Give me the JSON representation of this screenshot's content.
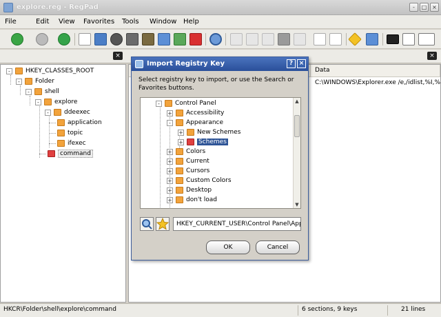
{
  "window": {
    "title": "explore.reg - RegPad",
    "controls": [
      "-",
      "□",
      "×"
    ]
  },
  "menu": [
    "File",
    "Edit",
    "View",
    "Favorites",
    "Tools",
    "Window",
    "Help"
  ],
  "toolbar_icons": [
    "back-icon",
    "forward-icon",
    "refresh-icon",
    "new-icon",
    "open-icon",
    "close-icon",
    "save-icon",
    "save-all-icon",
    "import-icon",
    "export-icon",
    "stop-icon",
    "search-icon",
    "cut-icon",
    "copy-icon",
    "paste-icon",
    "delete-icon",
    "undo-icon",
    "new-key-icon",
    "new-value-icon",
    "favorites-icon",
    "import-favorites-icon",
    "close-tab-icon",
    "tile-icon",
    "layout-icon"
  ],
  "tab_close_label": "×",
  "tree": [
    {
      "label": "HKEY_CLASSES_ROOT",
      "level": 0,
      "expander": "-"
    },
    {
      "label": "Folder",
      "level": 1,
      "expander": "-"
    },
    {
      "label": "shell",
      "level": 2,
      "expander": "-"
    },
    {
      "label": "explore",
      "level": 3,
      "expander": "-"
    },
    {
      "label": "ddeexec",
      "level": 4,
      "expander": "-"
    },
    {
      "label": "application",
      "level": 5,
      "expander": ""
    },
    {
      "label": "topic",
      "level": 5,
      "expander": ""
    },
    {
      "label": "ifexec",
      "level": 5,
      "expander": ""
    },
    {
      "label": "command",
      "level": 4,
      "expander": "",
      "selected": true
    }
  ],
  "right_panel": {
    "header": "Data",
    "data": "C:\\WINDOWS\\Explorer.exe /e,/idlist,%I,%"
  },
  "dialog": {
    "title": "Import Registry Key",
    "help_label": "?",
    "close_label": "×",
    "instructions": "Select registry key to import, or use the Search or Favorites buttons.",
    "tree": [
      {
        "label": "Control Panel",
        "level": 0,
        "expander": "-"
      },
      {
        "label": "Accessibility",
        "level": 1,
        "expander": "+"
      },
      {
        "label": "Appearance",
        "level": 1,
        "expander": "-"
      },
      {
        "label": "New Schemes",
        "level": 2,
        "expander": "+"
      },
      {
        "label": "Schemes",
        "level": 2,
        "expander": "+",
        "selected": true
      },
      {
        "label": "Colors",
        "level": 1,
        "expander": "+"
      },
      {
        "label": "Current",
        "level": 1,
        "expander": "+"
      },
      {
        "label": "Cursors",
        "level": 1,
        "expander": "+"
      },
      {
        "label": "Custom Colors",
        "level": 1,
        "expander": "+"
      },
      {
        "label": "Desktop",
        "level": 1,
        "expander": "+"
      },
      {
        "label": "don't load",
        "level": 1,
        "expander": "+"
      }
    ],
    "path_value": "HKEY_CURRENT_USER\\Control Panel\\Appearance",
    "ok_label": "OK",
    "cancel_label": "Cancel"
  },
  "status": {
    "path": "HKCR\\Folder\\shell\\explore\\command",
    "counts": "6 sections, 9 keys",
    "lines": "21 lines"
  }
}
